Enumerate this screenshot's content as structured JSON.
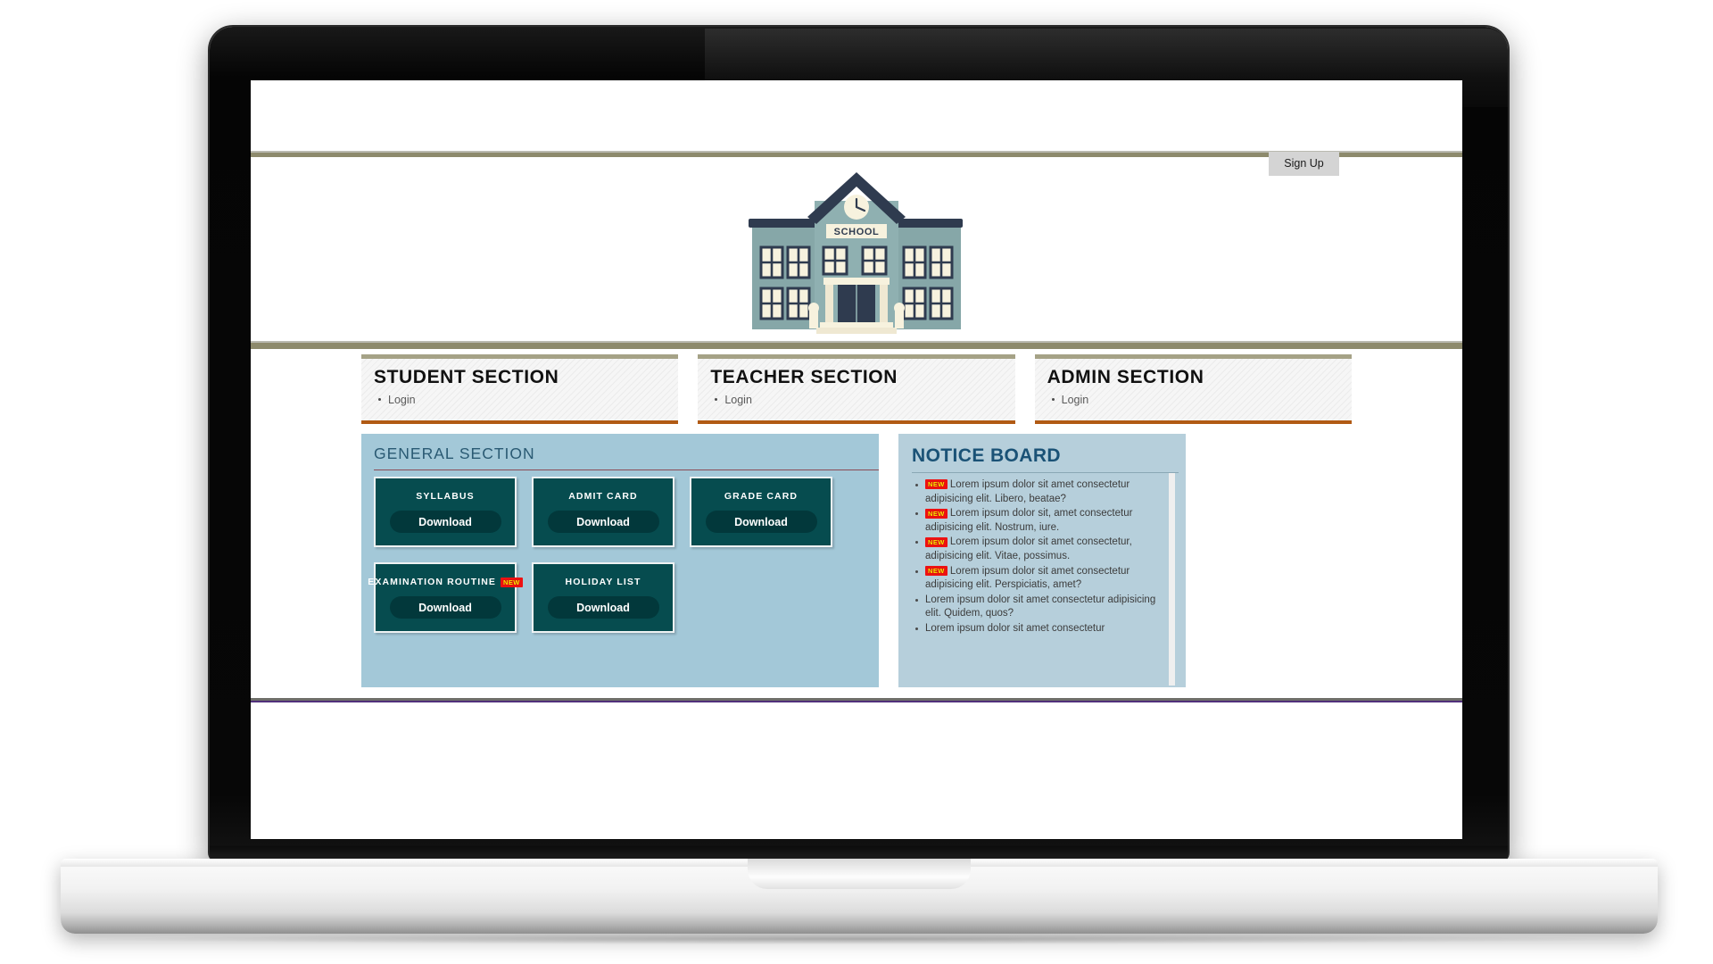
{
  "header": {
    "signup_label": "Sign Up"
  },
  "hero": {
    "illustration_name": "school-building-illustration",
    "building_sign": "SCHOOL"
  },
  "role_sections": [
    {
      "title": "STUDENT SECTION",
      "links": [
        "Login"
      ]
    },
    {
      "title": "TEACHER SECTION",
      "links": [
        "Login"
      ]
    },
    {
      "title": "ADMIN SECTION",
      "links": [
        "Login"
      ]
    }
  ],
  "general_section": {
    "title": "GENERAL SECTION",
    "cards": [
      {
        "title": "SYLLABUS",
        "badge": "",
        "button": "Download"
      },
      {
        "title": "ADMIT CARD",
        "badge": "",
        "button": "Download"
      },
      {
        "title": "GRADE CARD",
        "badge": "",
        "button": "Download"
      },
      {
        "title": "EXAMINATION ROUTINE",
        "badge": "NEW",
        "button": "Download"
      },
      {
        "title": "HOLIDAY LIST",
        "badge": "",
        "button": "Download"
      }
    ]
  },
  "notice_board": {
    "title": "NOTICE BOARD",
    "items": [
      {
        "badge": "NEW",
        "text": "Lorem ipsum dolor sit amet consectetur adipisicing elit. Libero, beatae?"
      },
      {
        "badge": "NEW",
        "text": "Lorem ipsum dolor sit, amet consectetur adipisicing elit. Nostrum, iure."
      },
      {
        "badge": "NEW",
        "text": "Lorem ipsum dolor sit amet consectetur, adipisicing elit. Vitae, possimus."
      },
      {
        "badge": "NEW",
        "text": "Lorem ipsum dolor sit amet consectetur adipisicing elit. Perspiciatis, amet?"
      },
      {
        "badge": "",
        "text": "Lorem ipsum dolor sit amet consectetur adipisicing elit. Quidem, quos?"
      },
      {
        "badge": "",
        "text": "Lorem ipsum dolor sit amet consectetur"
      }
    ]
  },
  "colors": {
    "rule_olive": "#8d8a6c",
    "role_underline_orange": "#b15a14",
    "general_bg": "#a3c8d8",
    "card_teal": "#064c4f",
    "button_teal_dark": "#02383b",
    "notice_bg": "#b6cfdb",
    "notice_title": "#1a5276",
    "badge_red": "#ee1111",
    "badge_text_yellow": "#ffe900",
    "bottom_rule_purple": "#51307b"
  }
}
